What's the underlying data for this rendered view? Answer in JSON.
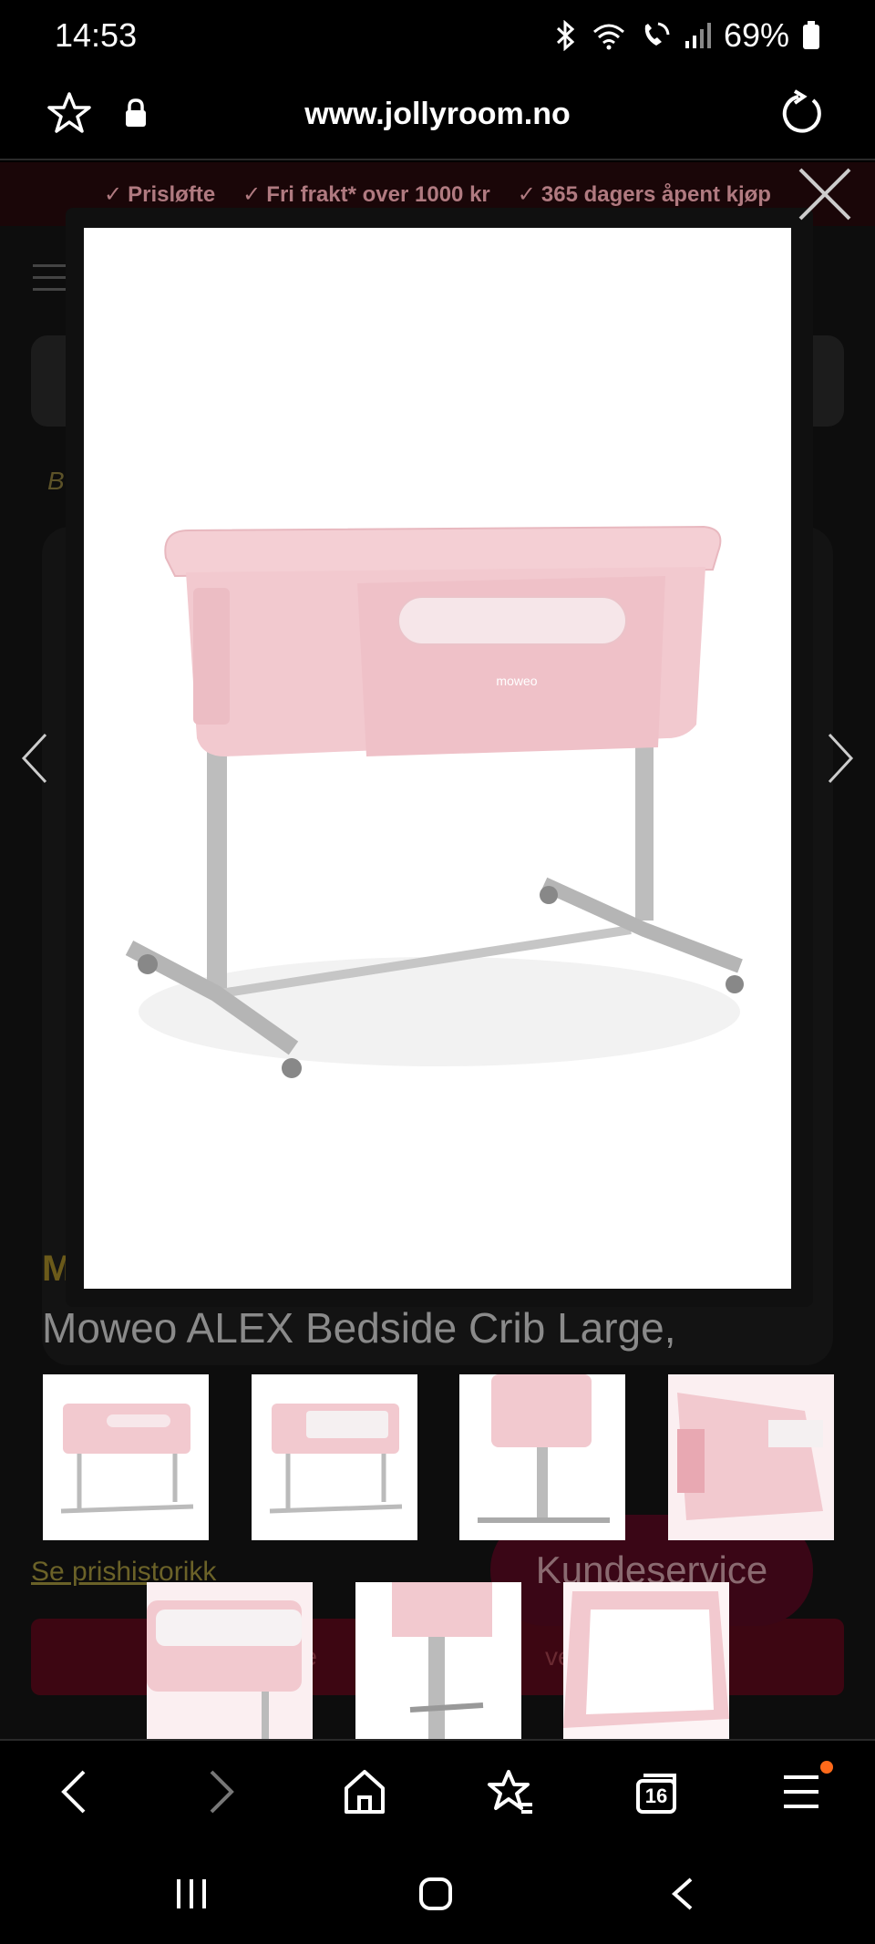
{
  "status_bar": {
    "time": "14:53",
    "battery_percent": "69%",
    "icons": [
      "bluetooth-icon",
      "wifi-icon",
      "wifi-call-icon",
      "signal-icon",
      "battery-icon"
    ]
  },
  "browser": {
    "url": "www.jollyroom.no",
    "tab_count": "16"
  },
  "promo": {
    "items": [
      "Prisløfte",
      "Fri frakt* over 1000 kr",
      "365 dagers åpent kjøp"
    ]
  },
  "page": {
    "breadcrumb": "B",
    "brand": "M",
    "title": "Moweo ALEX Bedside Crib Large,",
    "history_link": "Se prishistorikk",
    "support_button": "Kundeservice",
    "cta_left": "Le",
    "cta_right": "ven"
  },
  "lightbox": {
    "product_logo": "moweo",
    "thumbnail_count": 7
  },
  "colors": {
    "crib_pink": "#f2c9cf",
    "frame_grey": "#bdbdbd",
    "support_red": "#3a0616",
    "badge_orange": "#ff6a1a"
  }
}
